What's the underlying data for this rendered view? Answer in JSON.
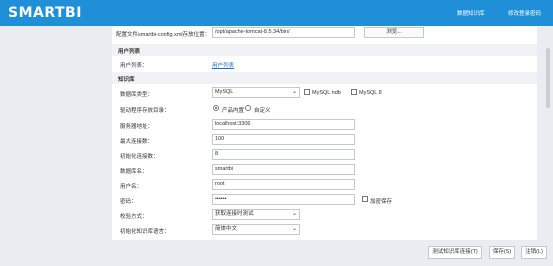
{
  "header": {
    "logo": "SMARTBI",
    "link_data_source": "数据知识库",
    "link_change_password": "修改登录密码"
  },
  "config": {
    "path_label": "配置文件smartbi-config.xml存放位置：",
    "path_value": "/opt/apache-tomcat-8.5.34/bin/",
    "browse_label": "浏览..."
  },
  "user_section": {
    "title": "用户列表",
    "user_list_label": "用户列表：",
    "user_list_link": "用户列表"
  },
  "kb_section": {
    "title": "知识库",
    "db_type_label": "数据库类型：",
    "db_type_value": "MySQL",
    "cb_ndb": "MySQL ndb",
    "cb_mysql8": "MySQL 8",
    "driver_label": "驱动程序存放目录：",
    "driver_builtin": "产品内置",
    "driver_custom": "自定义",
    "server_label": "服务器地址：",
    "server_value": "localhost:3306",
    "max_conn_label": "最大连接数：",
    "max_conn_value": "100",
    "init_conn_label": "初始化连接数：",
    "init_conn_value": "8",
    "db_name_label": "数据库名：",
    "db_name_value": "smartbi",
    "user_label": "用户名：",
    "user_value": "root",
    "password_label": "密码：",
    "password_value": "••••••",
    "save_password": "加密保存",
    "validation_label": "校验方式：",
    "validation_value": "获取连接时测试",
    "init_lang_label": "初始化知识库语言：",
    "init_lang_value": "简体中文"
  },
  "footer": {
    "test_button": "测试知识库连接(T)",
    "save_button": "保存(S)",
    "logout_button": "注销(L)"
  }
}
